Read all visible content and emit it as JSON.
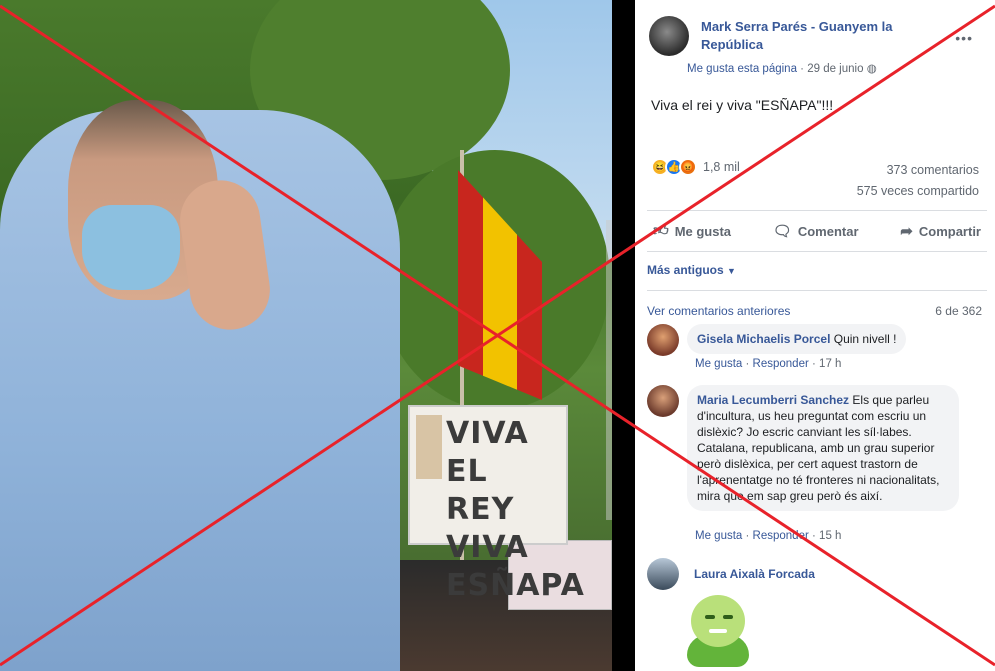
{
  "post": {
    "author": "Mark Serra Parés - Guanyem la República",
    "like_page": "Me gusta esta página",
    "date": "29 de junio",
    "text": "Viva el rei y viva \"ESÑAPA\"!!!",
    "reactions_count": "1,8 mil",
    "comments_count": "373 comentarios",
    "shares_count": "575 veces compartido",
    "actions": {
      "like": "Me gusta",
      "comment": "Comentar",
      "share": "Compartir"
    },
    "sort": "Más antiguos",
    "view_previous": "Ver comentarios anteriores",
    "pagination": "6 de 362"
  },
  "photo": {
    "sign_lines": [
      "VIVA",
      "EL REY",
      "VIVA",
      "ESÑAPA"
    ]
  },
  "comments": [
    {
      "name": "Gisela Michaelis Porcel",
      "text": "Quin nivell !",
      "like": "Me gusta",
      "reply": "Responder",
      "time": "17 h"
    },
    {
      "name": "Maria Lecumberri Sanchez",
      "text": "Els que parleu d'incultura, us heu preguntat com escriu un dislèxic? Jo escric canviant les síl·labes. Catalana, republicana, amb un grau superior però dislèxica, per cert aquest trastorn de l'aprenentatge no té fronteres ni nacionalitats, mira que em sap greu però és així.",
      "like": "Me gusta",
      "reply": "Responder",
      "time": "15 h"
    },
    {
      "name": "Laura Aixalà Forcada"
    }
  ],
  "colors": {
    "link": "#385898",
    "cross": "#e8222a",
    "muted": "#606770"
  }
}
